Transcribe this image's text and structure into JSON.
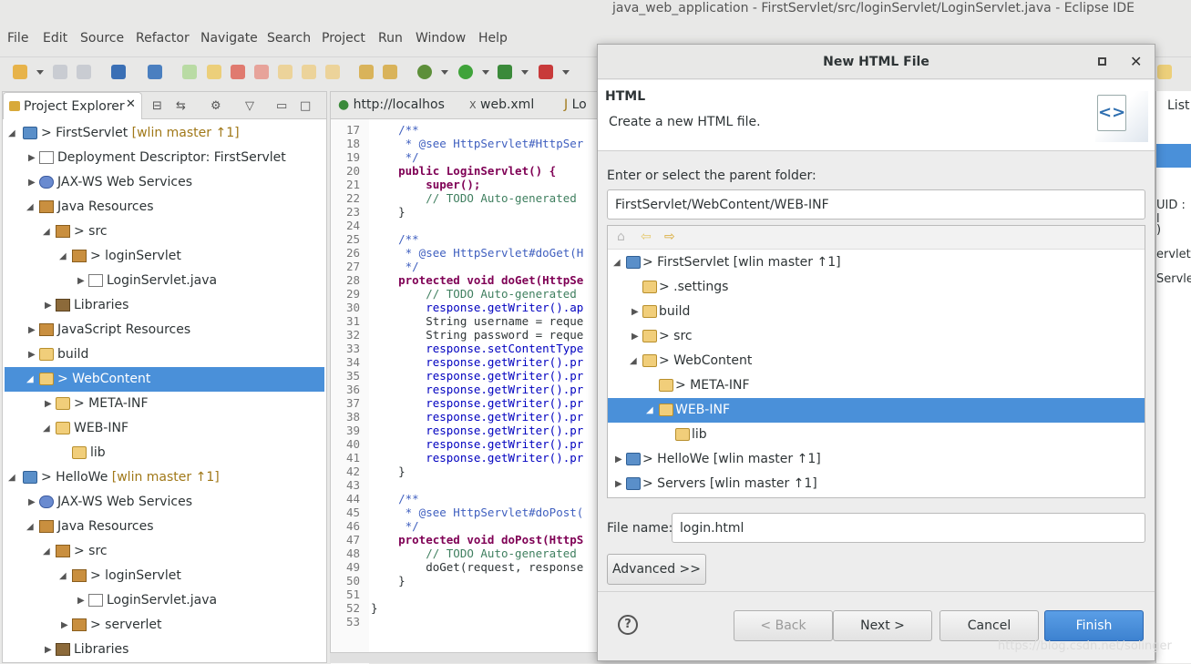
{
  "window": {
    "title": "java_web_application - FirstServlet/src/loginServlet/LoginServlet.java - Eclipse IDE"
  },
  "menu": [
    "File",
    "Edit",
    "Source",
    "Refactor",
    "Navigate",
    "Search",
    "Project",
    "Run",
    "Window",
    "Help"
  ],
  "explorer": {
    "tab_label": "Project Explorer",
    "close": "✕",
    "rows": [
      {
        "label": "> FirstServlet",
        "decor": " [wlin master ↑1]"
      },
      {
        "label": "Deployment Descriptor: FirstServlet"
      },
      {
        "label": "JAX-WS Web Services"
      },
      {
        "label": "Java Resources"
      },
      {
        "label": "> src"
      },
      {
        "label": "> loginServlet"
      },
      {
        "label": "LoginServlet.java"
      },
      {
        "label": "Libraries"
      },
      {
        "label": "JavaScript Resources"
      },
      {
        "label": "build"
      },
      {
        "label": "> WebContent"
      },
      {
        "label": "> META-INF"
      },
      {
        "label": "WEB-INF"
      },
      {
        "label": "lib"
      },
      {
        "label": "> HelloWe",
        "decor": " [wlin master ↑1]"
      },
      {
        "label": "JAX-WS Web Services"
      },
      {
        "label": "Java Resources"
      },
      {
        "label": "> src"
      },
      {
        "label": "> loginServlet"
      },
      {
        "label": "LoginServlet.java"
      },
      {
        "label": "> serverlet"
      },
      {
        "label": "Libraries"
      }
    ]
  },
  "editor": {
    "tabs": [
      "http://localhos",
      "web.xml",
      "Lo"
    ],
    "lines": [
      {
        "n": "17",
        "code": "    /**"
      },
      {
        "n": "18",
        "code": "     * @see HttpServlet#HttpSer"
      },
      {
        "n": "19",
        "code": "     */"
      },
      {
        "n": "20",
        "code": "    public LoginServlet() {"
      },
      {
        "n": "21",
        "code": "        super();"
      },
      {
        "n": "22",
        "code": "        // TODO Auto-generated"
      },
      {
        "n": "23",
        "code": "    }"
      },
      {
        "n": "24",
        "code": ""
      },
      {
        "n": "25",
        "code": "    /**"
      },
      {
        "n": "26",
        "code": "     * @see HttpServlet#doGet(H"
      },
      {
        "n": "27",
        "code": "     */"
      },
      {
        "n": "28",
        "code": "    protected void doGet(HttpSe"
      },
      {
        "n": "29",
        "code": "        // TODO Auto-generated"
      },
      {
        "n": "30",
        "code": "        response.getWriter().ap"
      },
      {
        "n": "31",
        "code": "        String username = reque"
      },
      {
        "n": "32",
        "code": "        String password = reque"
      },
      {
        "n": "33",
        "code": "        response.setContentType"
      },
      {
        "n": "34",
        "code": "        response.getWriter().pr"
      },
      {
        "n": "35",
        "code": "        response.getWriter().pr"
      },
      {
        "n": "36",
        "code": "        response.getWriter().pr"
      },
      {
        "n": "37",
        "code": "        response.getWriter().pr"
      },
      {
        "n": "38",
        "code": "        response.getWriter().pr"
      },
      {
        "n": "39",
        "code": "        response.getWriter().pr"
      },
      {
        "n": "40",
        "code": "        response.getWriter().pr"
      },
      {
        "n": "41",
        "code": "        response.getWriter().pr"
      },
      {
        "n": "42",
        "code": "    }"
      },
      {
        "n": "43",
        "code": ""
      },
      {
        "n": "44",
        "code": "    /**"
      },
      {
        "n": "45",
        "code": "     * @see HttpServlet#doPost("
      },
      {
        "n": "46",
        "code": "     */"
      },
      {
        "n": "47",
        "code": "    protected void doPost(HttpS"
      },
      {
        "n": "48",
        "code": "        // TODO Auto-generated"
      },
      {
        "n": "49",
        "code": "        doGet(request, response"
      },
      {
        "n": "50",
        "code": "    }"
      },
      {
        "n": "51",
        "code": ""
      },
      {
        "n": "52",
        "code": "}"
      },
      {
        "n": "53",
        "code": ""
      }
    ]
  },
  "right_panel": {
    "tab": "List",
    "lines": [
      "UID : l",
      ")",
      "ervlet",
      "Servle"
    ]
  },
  "dialog": {
    "title": "New HTML File",
    "header_title": "HTML",
    "header_message": "Create a new HTML file.",
    "parent_label": "Enter or select the parent folder:",
    "parent_value": "FirstServlet/WebContent/WEB-INF",
    "tree": [
      {
        "label": "> FirstServlet [wlin master ↑1]"
      },
      {
        "label": "> .settings"
      },
      {
        "label": "build"
      },
      {
        "label": "> src"
      },
      {
        "label": "> WebContent"
      },
      {
        "label": "> META-INF"
      },
      {
        "label": "WEB-INF"
      },
      {
        "label": "lib"
      },
      {
        "label": "> HelloWe [wlin master ↑1]"
      },
      {
        "label": "> Servers [wlin master ↑1]"
      }
    ],
    "filename_label": "File name:",
    "filename_value": "login.html",
    "advanced": "Advanced >>",
    "help": "?",
    "back": "< Back",
    "next": "Next >",
    "cancel": "Cancel",
    "finish": "Finish"
  },
  "watermark": "https://blog.csdn.net/solinger"
}
